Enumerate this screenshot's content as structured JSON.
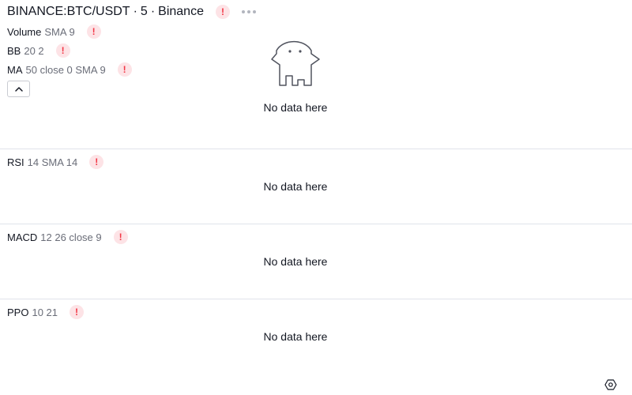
{
  "header": {
    "symbol": "BINANCE:BTC/USDT",
    "sep1": "·",
    "interval": "5",
    "sep2": "·",
    "exchange": "Binance",
    "error_mark": "!",
    "more_icon": "ellipsis-icon"
  },
  "main_pane": {
    "indicators": [
      {
        "name": "Volume",
        "params": "SMA 9",
        "error_mark": "!"
      },
      {
        "name": "BB",
        "params": "20 2",
        "error_mark": "!"
      },
      {
        "name": "MA",
        "params": "50 close 0 SMA 9",
        "error_mark": "!"
      }
    ],
    "collapse_icon": "chevron-up-icon",
    "empty_icon": "ghost-icon",
    "no_data": "No data here"
  },
  "rsi_pane": {
    "name": "RSI",
    "params": "14 SMA 14",
    "error_mark": "!",
    "no_data": "No data here"
  },
  "macd_pane": {
    "name": "MACD",
    "params": "12 26 close 9",
    "error_mark": "!",
    "no_data": "No data here"
  },
  "ppo_pane": {
    "name": "PPO",
    "params": "10 21",
    "error_mark": "!",
    "no_data": "No data here"
  },
  "footer": {
    "settings_icon": "gear-icon"
  },
  "colors": {
    "text": "#131722",
    "muted": "#6a6d78",
    "error": "#f23645",
    "error_bg": "#fde3e6",
    "divider": "#e0e3eb"
  }
}
